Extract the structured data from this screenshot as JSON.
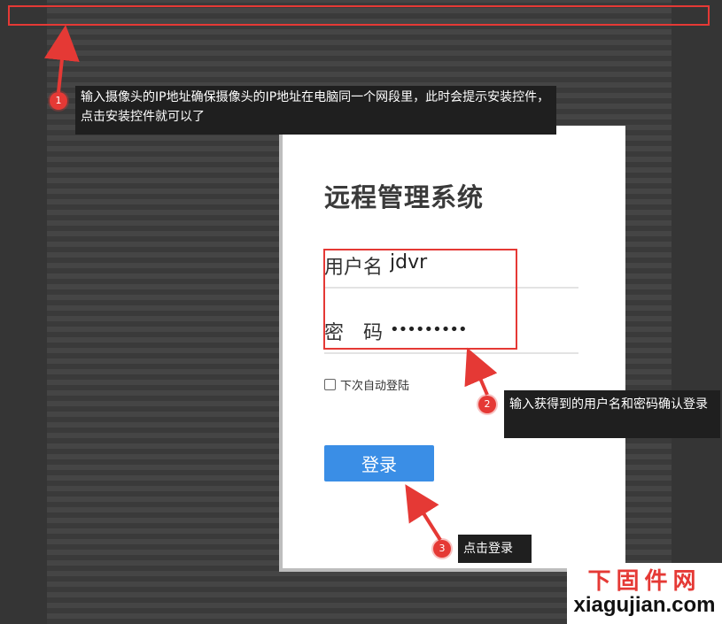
{
  "login": {
    "title": "远程管理系统",
    "username_label": "用户名",
    "username_value": "jdvr",
    "password_label": "密　码",
    "password_value": "•••••••••",
    "remember_label": "下次自动登陆",
    "submit_label": "登录",
    "button_color": "#3a8ee6"
  },
  "annotations": [
    {
      "number": "1",
      "text": "输入摄像头的IP地址确保摄像头的IP地址在电脑同一个网段里，此时会提示安装控件，点击安装控件就可以了"
    },
    {
      "number": "2",
      "text": "输入获得到的用户名和密码确认登录"
    },
    {
      "number": "3",
      "text": "点击登录"
    }
  ],
  "highlight_color": "#e53935",
  "watermark": {
    "chinese": "下固件网",
    "url": "xiagujian.com"
  }
}
